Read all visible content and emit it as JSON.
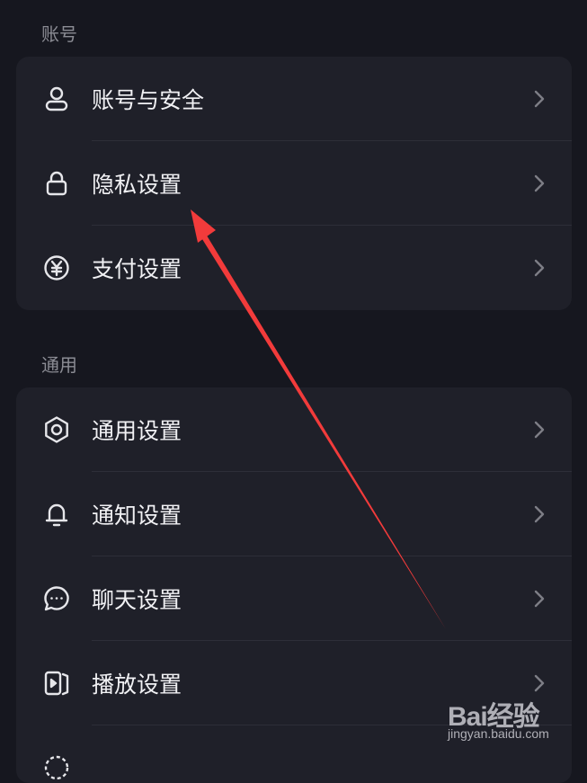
{
  "sections": [
    {
      "title": "账号",
      "items": [
        {
          "label": "账号与安全",
          "icon": "user-icon"
        },
        {
          "label": "隐私设置",
          "icon": "lock-icon"
        },
        {
          "label": "支付设置",
          "icon": "yuan-icon"
        }
      ]
    },
    {
      "title": "通用",
      "items": [
        {
          "label": "通用设置",
          "icon": "gear-icon"
        },
        {
          "label": "通知设置",
          "icon": "bell-icon"
        },
        {
          "label": "聊天设置",
          "icon": "chat-icon"
        },
        {
          "label": "播放设置",
          "icon": "play-icon"
        }
      ]
    }
  ],
  "annotation": {
    "color": "#f23b3b"
  },
  "watermark": {
    "logo_text": "Bai经验",
    "url": "jingyan.baidu.com"
  }
}
